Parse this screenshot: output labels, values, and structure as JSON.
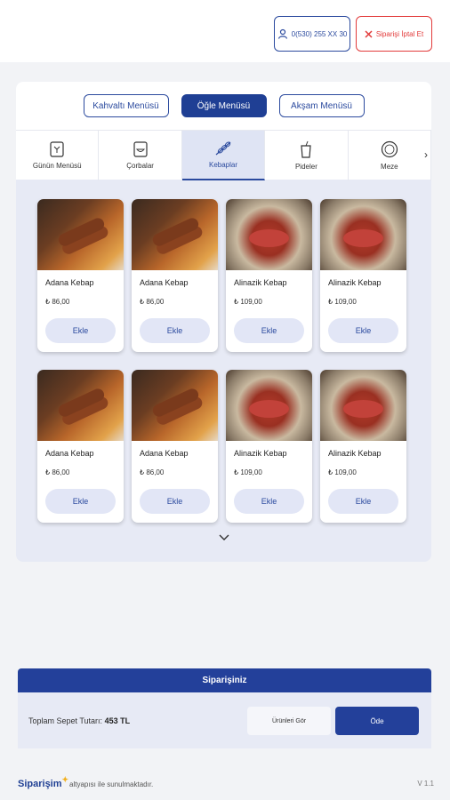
{
  "header": {
    "phone": "0(530) 255 XX 30",
    "cancel_label": "Siparişi İptal Et"
  },
  "meal_tabs": [
    "Kahvaltı Menüsü",
    "Öğle Menüsü",
    "Akşam Menüsü"
  ],
  "meal_active": "Öğle Menüsü",
  "categories": [
    "Günün Menüsü",
    "Çorbalar",
    "Kebaplar",
    "Pideler",
    "Meze"
  ],
  "category_active": "Kebaplar",
  "products": [
    {
      "name": "Adana Kebap",
      "price": "₺ 86,00",
      "add_label": "Ekle",
      "image": "adana"
    },
    {
      "name": "Adana Kebap",
      "price": "₺ 86,00",
      "add_label": "Ekle",
      "image": "adana"
    },
    {
      "name": "Alinazik Kebap",
      "price": "₺ 109,00",
      "add_label": "Ekle",
      "image": "alinazik"
    },
    {
      "name": "Alinazik Kebap",
      "price": "₺ 109,00",
      "add_label": "Ekle",
      "image": "alinazik"
    },
    {
      "name": "Adana Kebap",
      "price": "₺ 86,00",
      "add_label": "Ekle",
      "image": "adana"
    },
    {
      "name": "Adana Kebap",
      "price": "₺ 86,00",
      "add_label": "Ekle",
      "image": "adana"
    },
    {
      "name": "Alinazik Kebap",
      "price": "₺ 109,00",
      "add_label": "Ekle",
      "image": "alinazik"
    },
    {
      "name": "Alinazik Kebap",
      "price": "₺ 109,00",
      "add_label": "Ekle",
      "image": "alinazik"
    }
  ],
  "order": {
    "title": "Siparişiniz",
    "total_label": "Toplam Sepet Tutarı:",
    "total_value": "453 TL",
    "view_label": "Ürünleri Gör",
    "pay_label": "Öde"
  },
  "footer": {
    "brand": "Siparişim",
    "text": "altyapısı ile sunulmaktadır.",
    "version": "V 1.1"
  },
  "colors": {
    "primary": "#23409a",
    "danger": "#e23b3b",
    "panel": "#e7eaf5"
  }
}
